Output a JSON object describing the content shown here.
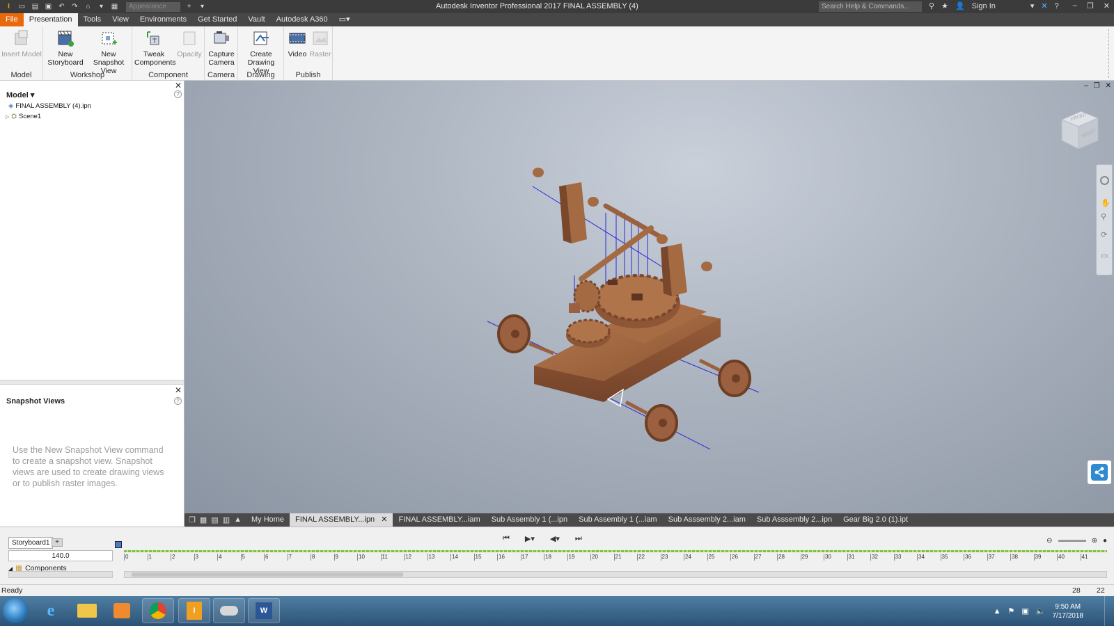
{
  "window": {
    "title": "Autodesk Inventor Professional 2017   FINAL ASSEMBLY (4)",
    "appearance_placeholder": "Appearance",
    "search_placeholder": "Search Help & Commands...",
    "sign_in": "Sign In"
  },
  "menu_tabs": [
    "File",
    "Presentation",
    "Tools",
    "View",
    "Environments",
    "Get Started",
    "Vault",
    "Autodesk A360"
  ],
  "active_tab": "Presentation",
  "ribbon": {
    "groups": [
      {
        "title": "Model",
        "buttons": [
          {
            "label": "Insert Model",
            "enabled": false
          }
        ]
      },
      {
        "title": "Workshop",
        "buttons": [
          {
            "label": "New Storyboard",
            "enabled": true
          },
          {
            "label": "New Snapshot View",
            "enabled": true
          }
        ]
      },
      {
        "title": "Component",
        "buttons": [
          {
            "label": "Tweak Components",
            "enabled": true
          },
          {
            "label": "Opacity",
            "enabled": false
          }
        ]
      },
      {
        "title": "Camera",
        "buttons": [
          {
            "label": "Capture Camera",
            "enabled": true
          }
        ]
      },
      {
        "title": "Drawing",
        "buttons": [
          {
            "label": "Create Drawing View",
            "enabled": true
          }
        ]
      },
      {
        "title": "Publish",
        "buttons": [
          {
            "label": "Video",
            "enabled": true
          },
          {
            "label": "Raster",
            "enabled": false
          }
        ]
      }
    ]
  },
  "browser": {
    "header": "Model",
    "tree": [
      {
        "label": "FINAL ASSEMBLY (4).ipn"
      },
      {
        "label": "Scene1"
      }
    ]
  },
  "snapshot_views": {
    "header": "Snapshot Views",
    "message": "Use the New Snapshot View command to create a snapshot view. Snapshot views are used to create drawing views or to publish raster images."
  },
  "doc_tabs": [
    {
      "label": "My Home",
      "active": false
    },
    {
      "label": "FINAL ASSEMBLY...ipn",
      "active": true
    },
    {
      "label": "FINAL ASSEMBLY...iam",
      "active": false
    },
    {
      "label": "Sub Assembly 1 (...ipn",
      "active": false
    },
    {
      "label": "Sub Assembly 1 (...iam",
      "active": false
    },
    {
      "label": "Sub Asssembly 2...iam",
      "active": false
    },
    {
      "label": "Sub Asssembly 2...ipn",
      "active": false
    },
    {
      "label": "Gear Big 2.0 (1).ipt",
      "active": false
    }
  ],
  "storyboard": {
    "tab_label": "Storyboard1",
    "add_label": "+",
    "time_value": "140.0",
    "components_label": "Components",
    "ticks": [
      "0",
      "1",
      "2",
      "3",
      "4",
      "5",
      "6",
      "7",
      "8",
      "9",
      "10",
      "11",
      "12",
      "13",
      "14",
      "15",
      "16",
      "17",
      "18",
      "19",
      "20",
      "21",
      "22",
      "23",
      "24",
      "25",
      "26",
      "27",
      "28",
      "29",
      "30",
      "31",
      "32",
      "33",
      "34",
      "35",
      "36",
      "37",
      "38",
      "39",
      "40",
      "41"
    ]
  },
  "status": {
    "text": "Ready",
    "value1": "28",
    "value2": "22"
  },
  "taskbar": {
    "time": "9:50 AM",
    "date": "7/17/2018"
  },
  "colors": {
    "file_tab": "#e8690c",
    "wood": "#a0653e",
    "axis_lines": "#2a2ad8"
  }
}
